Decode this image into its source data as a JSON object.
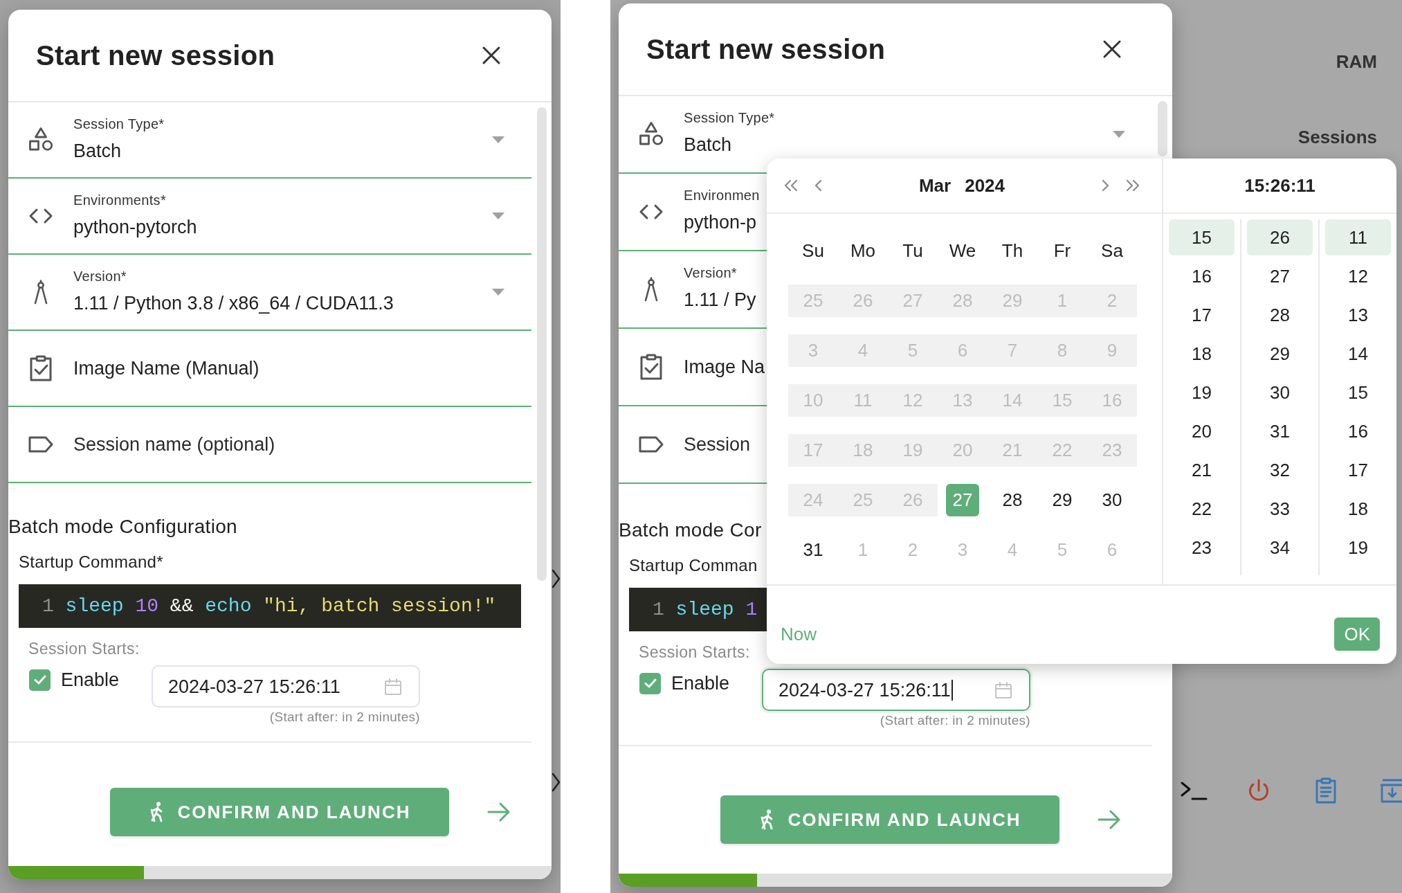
{
  "screens": [
    {
      "dialog": {
        "title": "Start new session",
        "fields": [
          {
            "kind": "select",
            "label": "Session Type*",
            "value": "Batch"
          },
          {
            "kind": "select",
            "label": "Environments*",
            "value": "python-pytorch"
          },
          {
            "kind": "select",
            "label": "Version*",
            "value": "1.11 / Python 3.8 / x86_64 / CUDA11.3"
          },
          {
            "kind": "option",
            "label": "Image Name (Manual)"
          },
          {
            "kind": "text_input",
            "placeholder": "Session name (optional)"
          }
        ],
        "batch_heading": "Batch mode Configuration",
        "command_label": "Startup Command*",
        "code_lines": [
          {
            "number": "1",
            "tokens": [
              {
                "text": "sleep",
                "kind": "command"
              },
              {
                "text": "10",
                "kind": "number"
              },
              {
                "text": "&&",
                "kind": "operator"
              },
              {
                "text": "echo",
                "kind": "command"
              },
              {
                "text": "\"hi, batch session!\"",
                "kind": "string"
              }
            ]
          }
        ],
        "schedule": {
          "label": "Session Starts:",
          "enable_label": "Enable",
          "enabled": true,
          "value": "2024-03-27 15:26:11",
          "focused": false,
          "hint": "(Start after: in 2 minutes)"
        },
        "launch_label": "CONFIRM AND LAUNCH",
        "progress": {
          "level": 0.25
        }
      }
    },
    {
      "backdrop": {
        "labels": [
          {
            "text": "RAM",
            "kind": "heading"
          },
          {
            "text": "Sessions",
            "kind": "heading"
          }
        ]
      },
      "dialog": {
        "title": "Start new session",
        "fields": [
          {
            "kind": "select",
            "label": "Session Type*",
            "value": "Batch"
          },
          {
            "kind": "select",
            "label": "Environmen",
            "value": "python-p"
          },
          {
            "kind": "select",
            "label": "Version*",
            "value": "1.11 / Py"
          },
          {
            "kind": "option",
            "label": "Image Na"
          },
          {
            "kind": "text_input",
            "placeholder": "Session"
          }
        ],
        "batch_heading": "Batch mode Cor",
        "command_label": "Startup Comman",
        "code_lines": [
          {
            "number": "1",
            "tokens": [
              {
                "text": "sleep",
                "kind": "command"
              },
              {
                "text": "1",
                "kind": "number"
              }
            ]
          }
        ],
        "schedule": {
          "label": "Session Starts:",
          "enable_label": "Enable",
          "enabled": true,
          "value": "2024-03-27 15:26:11",
          "focused": true,
          "hint": "(Start after: in 2 minutes)"
        },
        "launch_label": "CONFIRM AND LAUNCH",
        "progress": {
          "level": 0.25
        }
      },
      "date_picker": {
        "month": "Mar",
        "year": "2024",
        "weekdays": [
          "Su",
          "Mo",
          "Tu",
          "We",
          "Th",
          "Fr",
          "Sa"
        ],
        "weeks": [
          {
            "days": [
              {
                "label": "25",
                "kind": "past",
                "selected": false
              },
              {
                "label": "26",
                "kind": "past",
                "selected": false
              },
              {
                "label": "27",
                "kind": "past",
                "selected": false
              },
              {
                "label": "28",
                "kind": "past",
                "selected": false
              },
              {
                "label": "29",
                "kind": "past",
                "selected": false
              },
              {
                "label": "1",
                "kind": "past",
                "selected": false
              },
              {
                "label": "2",
                "kind": "past",
                "selected": false
              }
            ]
          },
          {
            "days": [
              {
                "label": "3",
                "kind": "past",
                "selected": false
              },
              {
                "label": "4",
                "kind": "past",
                "selected": false
              },
              {
                "label": "5",
                "kind": "past",
                "selected": false
              },
              {
                "label": "6",
                "kind": "past",
                "selected": false
              },
              {
                "label": "7",
                "kind": "past",
                "selected": false
              },
              {
                "label": "8",
                "kind": "past",
                "selected": false
              },
              {
                "label": "9",
                "kind": "past",
                "selected": false
              }
            ]
          },
          {
            "days": [
              {
                "label": "10",
                "kind": "past",
                "selected": false
              },
              {
                "label": "11",
                "kind": "past",
                "selected": false
              },
              {
                "label": "12",
                "kind": "past",
                "selected": false
              },
              {
                "label": "13",
                "kind": "past",
                "selected": false
              },
              {
                "label": "14",
                "kind": "past",
                "selected": false
              },
              {
                "label": "15",
                "kind": "past",
                "selected": false
              },
              {
                "label": "16",
                "kind": "past",
                "selected": false
              }
            ]
          },
          {
            "days": [
              {
                "label": "17",
                "kind": "past",
                "selected": false
              },
              {
                "label": "18",
                "kind": "past",
                "selected": false
              },
              {
                "label": "19",
                "kind": "past",
                "selected": false
              },
              {
                "label": "20",
                "kind": "past",
                "selected": false
              },
              {
                "label": "21",
                "kind": "past",
                "selected": false
              },
              {
                "label": "22",
                "kind": "past",
                "selected": false
              },
              {
                "label": "23",
                "kind": "past",
                "selected": false
              }
            ]
          },
          {
            "days": [
              {
                "label": "24",
                "kind": "past",
                "selected": false
              },
              {
                "label": "25",
                "kind": "past",
                "selected": false
              },
              {
                "label": "26",
                "kind": "past",
                "selected": false
              },
              {
                "label": "27",
                "kind": "current",
                "selected": true
              },
              {
                "label": "28",
                "kind": "current",
                "selected": false
              },
              {
                "label": "29",
                "kind": "current",
                "selected": false
              },
              {
                "label": "30",
                "kind": "current",
                "selected": false
              }
            ]
          },
          {
            "days": [
              {
                "label": "31",
                "kind": "current",
                "selected": false
              },
              {
                "label": "1",
                "kind": "outside",
                "selected": false
              },
              {
                "label": "2",
                "kind": "outside",
                "selected": false
              },
              {
                "label": "3",
                "kind": "outside",
                "selected": false
              },
              {
                "label": "4",
                "kind": "outside",
                "selected": false
              },
              {
                "label": "5",
                "kind": "outside",
                "selected": false
              },
              {
                "label": "6",
                "kind": "outside",
                "selected": false
              }
            ]
          }
        ],
        "time": "15:26:11",
        "time_columns": [
          {
            "options": [
              {
                "label": "15",
                "selected": true
              },
              {
                "label": "16",
                "selected": false
              },
              {
                "label": "17",
                "selected": false
              },
              {
                "label": "18",
                "selected": false
              },
              {
                "label": "19",
                "selected": false
              },
              {
                "label": "20",
                "selected": false
              },
              {
                "label": "21",
                "selected": false
              },
              {
                "label": "22",
                "selected": false
              },
              {
                "label": "23",
                "selected": false
              }
            ]
          },
          {
            "options": [
              {
                "label": "26",
                "selected": true
              },
              {
                "label": "27",
                "selected": false
              },
              {
                "label": "28",
                "selected": false
              },
              {
                "label": "29",
                "selected": false
              },
              {
                "label": "30",
                "selected": false
              },
              {
                "label": "31",
                "selected": false
              },
              {
                "label": "32",
                "selected": false
              },
              {
                "label": "33",
                "selected": false
              },
              {
                "label": "34",
                "selected": false
              }
            ]
          },
          {
            "options": [
              {
                "label": "11",
                "selected": true
              },
              {
                "label": "12",
                "selected": false
              },
              {
                "label": "13",
                "selected": false
              },
              {
                "label": "14",
                "selected": false
              },
              {
                "label": "15",
                "selected": false
              },
              {
                "label": "16",
                "selected": false
              },
              {
                "label": "17",
                "selected": false
              },
              {
                "label": "18",
                "selected": false
              },
              {
                "label": "19",
                "selected": false
              }
            ]
          }
        ],
        "now_label": "Now",
        "ok_label": "OK"
      }
    }
  ]
}
